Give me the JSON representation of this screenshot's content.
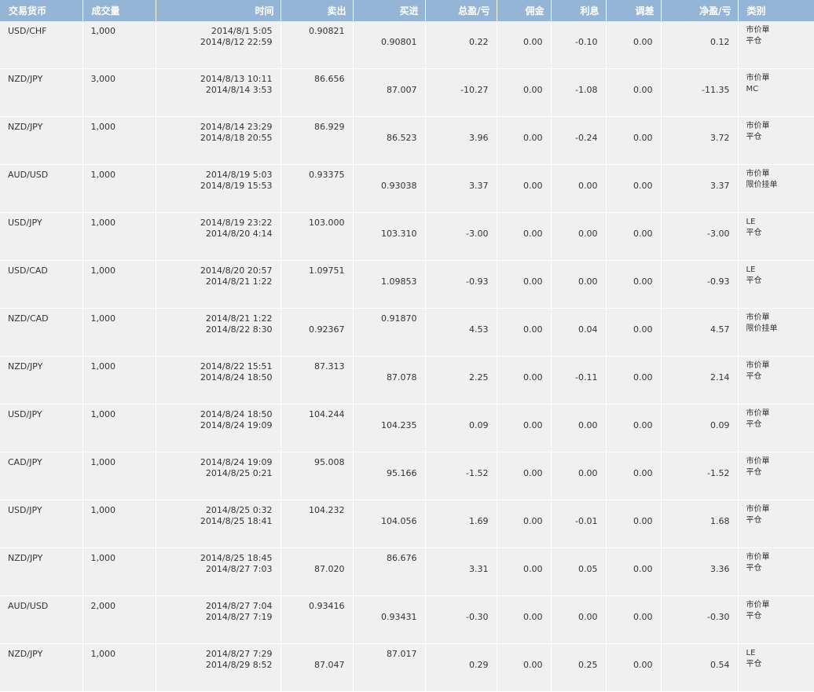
{
  "headers": [
    "交易货币",
    "成交量",
    "时间",
    "卖出",
    "买进",
    "总盈/亏",
    "佣金",
    "利息",
    "调差",
    "净盈/亏",
    "类别"
  ],
  "rows": [
    {
      "pair": "USD/CHF",
      "volume": "1,000",
      "time_open": "2014/8/1 5:05",
      "time_close": "2014/8/12 22:59",
      "sell": "0.90821",
      "buy": "0.90801",
      "sell_top": true,
      "gross": "0.22",
      "commission": "0.00",
      "interest": "-0.10",
      "adjust": "0.00",
      "net": "0.12",
      "type_open": "市价單",
      "type_close": "平仓"
    },
    {
      "pair": "NZD/JPY",
      "volume": "3,000",
      "time_open": "2014/8/13 10:11",
      "time_close": "2014/8/14 3:53",
      "sell": "86.656",
      "buy": "87.007",
      "sell_top": true,
      "gross": "-10.27",
      "commission": "0.00",
      "interest": "-1.08",
      "adjust": "0.00",
      "net": "-11.35",
      "type_open": "市价單",
      "type_close": "MC"
    },
    {
      "pair": "NZD/JPY",
      "volume": "1,000",
      "time_open": "2014/8/14 23:29",
      "time_close": "2014/8/18 20:55",
      "sell": "86.929",
      "buy": "86.523",
      "sell_top": true,
      "gross": "3.96",
      "commission": "0.00",
      "interest": "-0.24",
      "adjust": "0.00",
      "net": "3.72",
      "type_open": "市价單",
      "type_close": "平仓"
    },
    {
      "pair": "AUD/USD",
      "volume": "1,000",
      "time_open": "2014/8/19 5:03",
      "time_close": "2014/8/19 15:53",
      "sell": "0.93375",
      "buy": "0.93038",
      "sell_top": true,
      "gross": "3.37",
      "commission": "0.00",
      "interest": "0.00",
      "adjust": "0.00",
      "net": "3.37",
      "type_open": "市价單",
      "type_close": "限价挂单"
    },
    {
      "pair": "USD/JPY",
      "volume": "1,000",
      "time_open": "2014/8/19 23:22",
      "time_close": "2014/8/20 4:14",
      "sell": "103.000",
      "buy": "103.310",
      "sell_top": true,
      "gross": "-3.00",
      "commission": "0.00",
      "interest": "0.00",
      "adjust": "0.00",
      "net": "-3.00",
      "type_open": "LE",
      "type_close": "平仓"
    },
    {
      "pair": "USD/CAD",
      "volume": "1,000",
      "time_open": "2014/8/20 20:57",
      "time_close": "2014/8/21 1:22",
      "sell": "1.09751",
      "buy": "1.09853",
      "sell_top": true,
      "gross": "-0.93",
      "commission": "0.00",
      "interest": "0.00",
      "adjust": "0.00",
      "net": "-0.93",
      "type_open": "LE",
      "type_close": "平仓"
    },
    {
      "pair": "NZD/CAD",
      "volume": "1,000",
      "time_open": "2014/8/21 1:22",
      "time_close": "2014/8/22 8:30",
      "sell": "0.92367",
      "buy": "0.91870",
      "sell_top": false,
      "gross": "4.53",
      "commission": "0.00",
      "interest": "0.04",
      "adjust": "0.00",
      "net": "4.57",
      "type_open": "市价單",
      "type_close": "限价挂单"
    },
    {
      "pair": "NZD/JPY",
      "volume": "1,000",
      "time_open": "2014/8/22 15:51",
      "time_close": "2014/8/24 18:50",
      "sell": "87.313",
      "buy": "87.078",
      "sell_top": true,
      "gross": "2.25",
      "commission": "0.00",
      "interest": "-0.11",
      "adjust": "0.00",
      "net": "2.14",
      "type_open": "市价單",
      "type_close": "平仓"
    },
    {
      "pair": "USD/JPY",
      "volume": "1,000",
      "time_open": "2014/8/24 18:50",
      "time_close": "2014/8/24 19:09",
      "sell": "104.244",
      "buy": "104.235",
      "sell_top": true,
      "gross": "0.09",
      "commission": "0.00",
      "interest": "0.00",
      "adjust": "0.00",
      "net": "0.09",
      "type_open": "市价單",
      "type_close": "平仓"
    },
    {
      "pair": "CAD/JPY",
      "volume": "1,000",
      "time_open": "2014/8/24 19:09",
      "time_close": "2014/8/25 0:21",
      "sell": "95.008",
      "buy": "95.166",
      "sell_top": true,
      "gross": "-1.52",
      "commission": "0.00",
      "interest": "0.00",
      "adjust": "0.00",
      "net": "-1.52",
      "type_open": "市价單",
      "type_close": "平仓"
    },
    {
      "pair": "USD/JPY",
      "volume": "1,000",
      "time_open": "2014/8/25 0:32",
      "time_close": "2014/8/25 18:41",
      "sell": "104.232",
      "buy": "104.056",
      "sell_top": true,
      "gross": "1.69",
      "commission": "0.00",
      "interest": "-0.01",
      "adjust": "0.00",
      "net": "1.68",
      "type_open": "市价單",
      "type_close": "平仓"
    },
    {
      "pair": "NZD/JPY",
      "volume": "1,000",
      "time_open": "2014/8/25 18:45",
      "time_close": "2014/8/27 7:03",
      "sell": "87.020",
      "buy": "86.676",
      "sell_top": false,
      "gross": "3.31",
      "commission": "0.00",
      "interest": "0.05",
      "adjust": "0.00",
      "net": "3.36",
      "type_open": "市价單",
      "type_close": "平仓"
    },
    {
      "pair": "AUD/USD",
      "volume": "2,000",
      "time_open": "2014/8/27 7:04",
      "time_close": "2014/8/27 7:19",
      "sell": "0.93416",
      "buy": "0.93431",
      "sell_top": true,
      "gross": "-0.30",
      "commission": "0.00",
      "interest": "0.00",
      "adjust": "0.00",
      "net": "-0.30",
      "type_open": "市价單",
      "type_close": "平仓"
    },
    {
      "pair": "NZD/JPY",
      "volume": "1,000",
      "time_open": "2014/8/27 7:29",
      "time_close": "2014/8/29 8:52",
      "sell": "87.047",
      "buy": "87.017",
      "sell_top": false,
      "gross": "0.29",
      "commission": "0.00",
      "interest": "0.25",
      "adjust": "0.00",
      "net": "0.54",
      "type_open": "LE",
      "type_close": "平仓"
    }
  ]
}
